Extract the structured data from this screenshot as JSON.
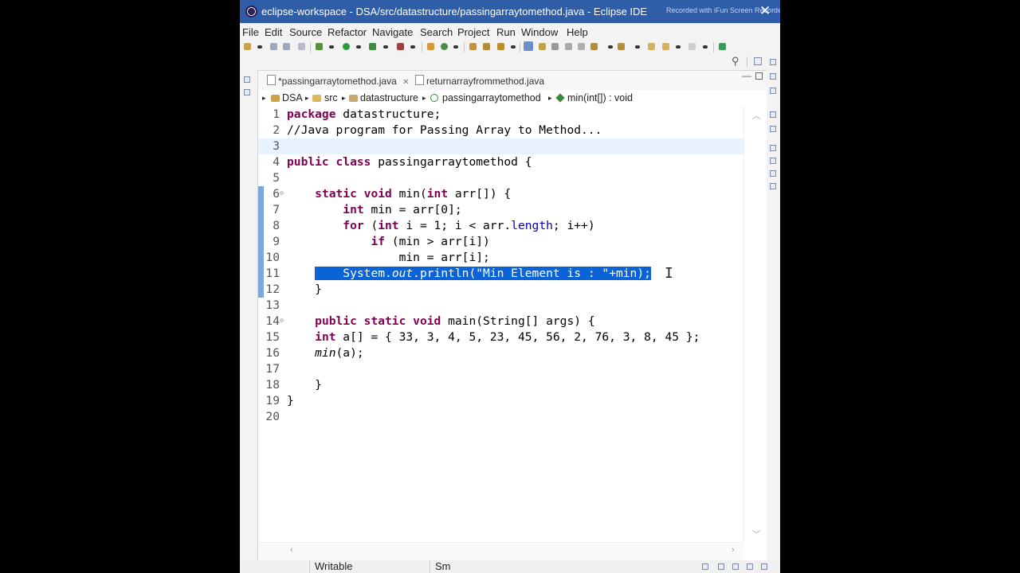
{
  "window": {
    "title": "eclipse-workspace - DSA/src/datastructure/passingarraytomethod.java - Eclipse IDE",
    "watermark": "Recorded with iFun Screen Recorder"
  },
  "menu": [
    "File",
    "Edit",
    "Source",
    "Refactor",
    "Navigate",
    "Search",
    "Project",
    "Run",
    "Window",
    "Help"
  ],
  "tabs": [
    {
      "label": "*passingarraytomethod.java",
      "active": true,
      "close": "✕"
    },
    {
      "label": "returnarrayfrommethod.java",
      "active": false
    }
  ],
  "breadcrumb": [
    "DSA",
    "src",
    "datastructure",
    "passingarraytomethod",
    "min(int[]) : void"
  ],
  "editor": {
    "line_numbers": [
      "1",
      "2",
      "3",
      "4",
      "5",
      "6",
      "7",
      "8",
      "9",
      "10",
      "11",
      "12",
      "13",
      "14",
      "15",
      "16",
      "17",
      "18",
      "19",
      "20"
    ],
    "selected_line": 11,
    "current_line": 3
  },
  "status": {
    "writable": "Writable",
    "insert_mode": "Sm"
  }
}
